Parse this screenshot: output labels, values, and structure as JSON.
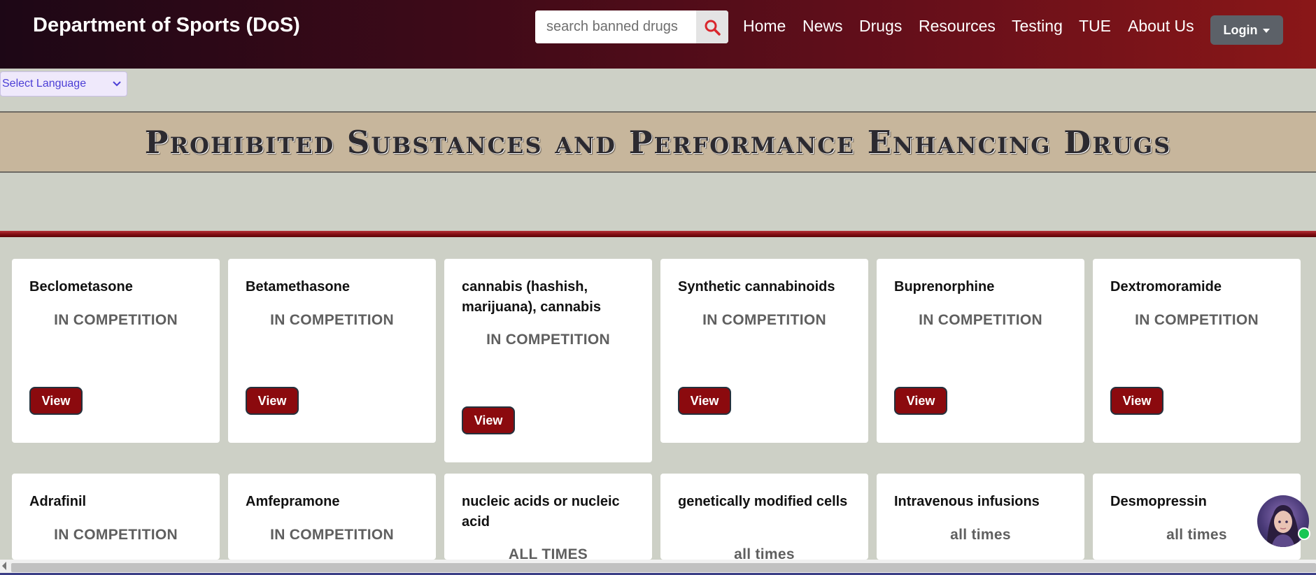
{
  "header": {
    "brand": "Department of Sports (DoS)",
    "search": {
      "placeholder": "search banned drugs",
      "value": ""
    },
    "nav": [
      "Home",
      "News",
      "Drugs",
      "Resources",
      "Testing",
      "TUE",
      "About Us"
    ],
    "login_label": "Login"
  },
  "language_select": {
    "selected": "Select Language"
  },
  "banner": {
    "title": "Prohibited Substances and Performance Enhancing Drugs"
  },
  "cards": [
    {
      "title": "Beclometasone",
      "status": "IN COMPETITION",
      "button": "View"
    },
    {
      "title": "Betamethasone",
      "status": "IN COMPETITION",
      "button": "View"
    },
    {
      "title": "cannabis (hashish, marijuana), cannabis",
      "status": "IN COMPETITION",
      "button": "View"
    },
    {
      "title": "Synthetic cannabinoids",
      "status": "IN COMPETITION",
      "button": "View"
    },
    {
      "title": "Buprenorphine",
      "status": "IN COMPETITION",
      "button": "View"
    },
    {
      "title": "Dextromoramide",
      "status": "IN COMPETITION",
      "button": "View"
    },
    {
      "title": "Adrafinil",
      "status": "IN COMPETITION"
    },
    {
      "title": "Amfepramone",
      "status": "IN COMPETITION"
    },
    {
      "title": "nucleic acids or nucleic acid",
      "status": "ALL TIMES"
    },
    {
      "title": "genetically modified cells",
      "status": "all times"
    },
    {
      "title": "Intravenous infusions",
      "status": "all times"
    },
    {
      "title": "Desmopressin",
      "status": "all times"
    }
  ],
  "colors": {
    "nav_gradient_start": "#1d0716",
    "nav_gradient_end": "#8a1718",
    "page_bg": "#cdd0c6",
    "banner_bg": "#c7b69c",
    "view_button": "#8b0a0e",
    "search_icon": "#d9262c"
  },
  "icons": {
    "search": "search-icon",
    "login_caret": "caret-down-icon",
    "language_chevron": "chevron-down-icon",
    "chat": "chat-avatar-icon"
  }
}
